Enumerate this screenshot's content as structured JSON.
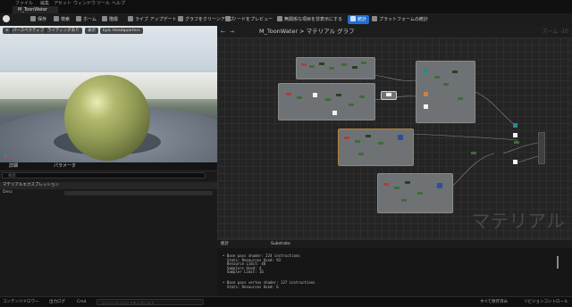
{
  "menu": [
    "ファイル",
    "編集",
    "アセット",
    "ウィンドウ",
    "ツール",
    "ヘルプ"
  ],
  "asset_tab": "M_ToonWater",
  "toolbar": {
    "save": "保存",
    "browse": "検索",
    "home": "ホーム",
    "hierarchy": "階層",
    "live_update": "ライブ アップデート",
    "clean_graph": "グラフをクリーンアップ",
    "node_preview": "ノードをプレビュー",
    "hide_unrelated": "無関係な項目を非表示にする",
    "stats": "統計",
    "platform_stats": "プラットフォームの統計"
  },
  "viewport": {
    "perspective": "パースペクティブ",
    "lit": "ライティングあり",
    "show": "表示",
    "hdri": "Epic Headquarters"
  },
  "details": {
    "tab_details": "詳細",
    "tab_params": "パラメータ",
    "search_placeholder": "検索",
    "section": "マテリアルエクスプレッション",
    "row_label": "Desc"
  },
  "graph": {
    "breadcrumb": "M_ToonWater > マテリアル グラフ",
    "zoom": "ズーム -10",
    "watermark": "マテリアル"
  },
  "stats": {
    "tab_stats": "統計",
    "tab_substrate": "Substrate",
    "pixel_block": "• Base pass shader: 224 instructions\n  Stats: Resources Used: 93\n  Resource Limit: 48\n  Samplers Used: 4\n  Sampler Limit: 16",
    "vertex_block": "• Base pass vertex shader: 137 instructions\n  Stats: Resources Used: 6"
  },
  "statusbar": {
    "content_drawer": "コンテンツドロワー",
    "output_log": "出力ログ",
    "cmd": "Cmd",
    "console_placeholder": "コンソールコマンドを入力します",
    "saved": "すべて保存済み",
    "revision": "リビジョンコントロール"
  }
}
